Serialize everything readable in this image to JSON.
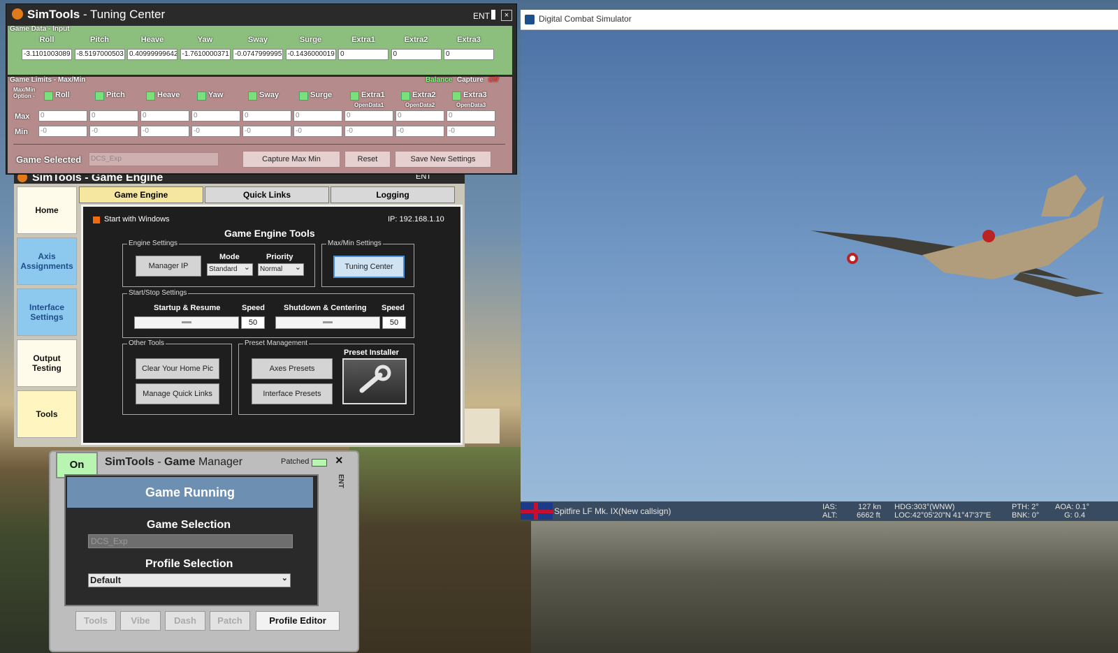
{
  "dcs": {
    "title": "Digital Combat Simulator",
    "status": {
      "aircraft": "Spitfire LF Mk. IX(New callsign)",
      "ias_label": "IAS:",
      "ias_value": "127 kn",
      "alt_label": "ALT:",
      "alt_value": "6662 ft",
      "hdg": "HDG:303°(WNW)",
      "loc": "LOC:42°05'20\"N 41°47'37\"E",
      "pth": "PTH: 2°",
      "bnk": "BNK: 0°",
      "aoa": "AOA: 0.1°",
      "g": "G: 0.4"
    }
  },
  "tuning_center": {
    "title_bold": "SimTools",
    "title_rest": " - Tuning Center",
    "ent": "ENT",
    "close": "×",
    "game_data_label": "Game Data - Input",
    "columns": [
      "Roll",
      "Pitch",
      "Heave",
      "Yaw",
      "Sway",
      "Surge",
      "Extra1",
      "Extra2",
      "Extra3"
    ],
    "values": [
      "-3.1101003089",
      "-8.5197000503",
      "0.40999999642",
      "-1.7610000371",
      "-0.0747999995",
      "-0.1436000019",
      "0",
      "0",
      "0"
    ],
    "limits_label": "Game Limits - Max/Min",
    "balance_label": "Balance",
    "capture_label": "Capture",
    "capture_state": "Off",
    "maxmin_option": "Max/Min Option -",
    "open_data": [
      "OpenData1",
      "OpenData2",
      "OpenData3"
    ],
    "max_label": "Max",
    "min_label": "Min",
    "max_values": [
      "0",
      "0",
      "0",
      "0",
      "0",
      "0",
      "0",
      "0",
      "0"
    ],
    "min_values": [
      "-0",
      "-0",
      "-0",
      "-0",
      "-0",
      "-0",
      "-0",
      "-0",
      "-0"
    ],
    "game_selected_label": "Game Selected",
    "game_selected_value": "DCS_Exp",
    "capture_btn": "Capture Max Min",
    "reset_btn": "Reset",
    "save_btn": "Save New Settings"
  },
  "game_engine": {
    "title": "SimTools - Game Engine",
    "ent": "ENT",
    "nav": [
      "Home",
      "Axis Assignments",
      "Interface Settings",
      "Output Testing",
      "Tools"
    ],
    "tabs": [
      "Game Engine",
      "Quick Links",
      "Logging"
    ],
    "start_with_windows": "Start with Windows",
    "ip": "IP: 192.168.1.10",
    "tools_title": "Game Engine Tools",
    "engine_settings": "Engine Settings",
    "manager_ip": "Manager IP",
    "mode_label": "Mode",
    "mode_value": "Standard",
    "priority_label": "Priority",
    "priority_value": "Normal",
    "maxmin_settings": "Max/Min Settings",
    "tuning_center_btn": "Tuning Center",
    "startstop": "Start/Stop Settings",
    "startup": "Startup & Resume",
    "speed": "Speed",
    "shutdown": "Shutdown & Centering",
    "startup_speed": "50",
    "shutdown_speed": "50",
    "other_tools": "Other Tools",
    "clear_pic": "Clear Your Home Pic",
    "manage_links": "Manage Quick Links",
    "preset_mgmt": "Preset Management",
    "axes_presets": "Axes Presets",
    "interface_presets": "Interface Presets",
    "preset_installer": "Preset Installer"
  },
  "game_manager": {
    "on": "On",
    "title_bold": "SimTools",
    "title_mid": " - ",
    "title_game": "Game",
    "title_rest": " Manager",
    "patched": "Patched",
    "ent": "ENT",
    "close": "×",
    "game_running": "Game Running",
    "game_selection": "Game Selection",
    "game_selection_value": "DCS_Exp",
    "profile_selection": "Profile Selection",
    "profile_value": "Default",
    "buttons": [
      "Tools",
      "Vibe",
      "Dash",
      "Patch",
      "Profile Editor"
    ]
  },
  "colors": {
    "game_data_bg": "#8cbf7e",
    "game_limits_bg": "#b58b8b",
    "nav_blue": "#8dc9ef",
    "capture_off": "#ff4040",
    "balance": "#7dff7d"
  }
}
